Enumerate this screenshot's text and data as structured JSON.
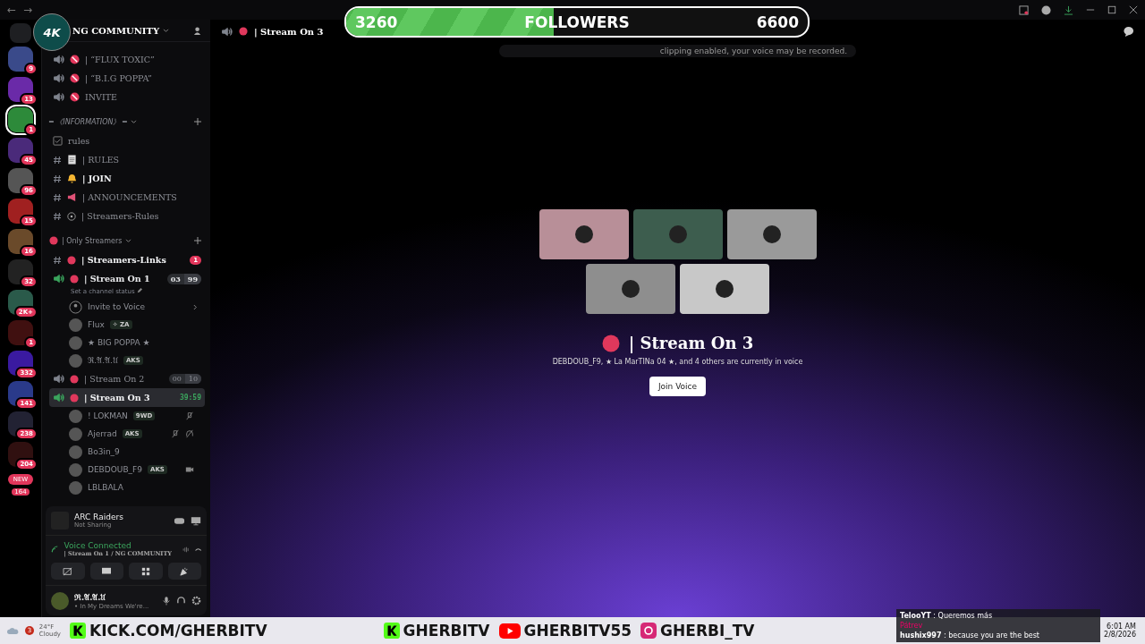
{
  "window": {
    "back": "←",
    "forward": "→"
  },
  "followers": {
    "current": "3260",
    "label": "FOLLOWERS",
    "goal": "6600",
    "level": 0.45
  },
  "stream_logo": {
    "text": "4K"
  },
  "servers": [
    {
      "badge": "9",
      "selected": false
    },
    {
      "badge": "13",
      "selected": false
    },
    {
      "badge": "1",
      "selected": true
    },
    {
      "badge": "45",
      "selected": false
    },
    {
      "badge": "96",
      "selected": false
    },
    {
      "badge": "15",
      "selected": false
    },
    {
      "badge": "16",
      "selected": false
    },
    {
      "badge": "32",
      "selected": false
    },
    {
      "badge": "2K+",
      "selected": false
    },
    {
      "badge": "1",
      "selected": false
    },
    {
      "badge": "332",
      "selected": false
    },
    {
      "badge": "141",
      "selected": false
    },
    {
      "badge": "238",
      "selected": false
    },
    {
      "badge": "204",
      "selected": false
    }
  ],
  "new_pill": {
    "label": "NEW",
    "count": "164"
  },
  "server_header": {
    "title": "NG COMMUNITY"
  },
  "channels": [
    {
      "kind": "voice",
      "name": "| “FLUX TOXIC”",
      "connected": false,
      "selected": false
    },
    {
      "kind": "voice",
      "name": "| “B.I.G POPPA”",
      "connected": false,
      "selected": false
    },
    {
      "kind": "voice",
      "name": "INVITE",
      "connected": false,
      "selected": false
    },
    {
      "kind": "category",
      "name": "═ 《INFORMATION》 ═",
      "children": [
        {
          "kind": "forum",
          "name": "rules",
          "unread": false
        },
        {
          "kind": "text",
          "name": "| RULES",
          "unread": false
        },
        {
          "kind": "text",
          "name": "| JOIN",
          "unread": true
        },
        {
          "kind": "text",
          "name": "| ANNOUNCEMENTS",
          "unread": false
        },
        {
          "kind": "text",
          "name": "| Streamers-Rules",
          "unread": false
        }
      ]
    },
    {
      "kind": "category",
      "name": "| Only Streamers",
      "children": [
        {
          "kind": "text",
          "name": "| Streamers-Links",
          "unread": true,
          "badge": "1"
        },
        {
          "kind": "voice",
          "name": "| Stream On 1",
          "connected": true,
          "selected": false,
          "counts": [
            "03",
            "99"
          ],
          "status": "Set a channel status",
          "children": [
            {
              "kind": "invite",
              "name": "Invite to Voice"
            },
            {
              "kind": "member",
              "name": "Flux",
              "tag": "✧ ZA",
              "muted": false,
              "deafened": false,
              "video": false
            },
            {
              "kind": "member",
              "name": "★ BIG POPPA ★",
              "muted": false,
              "deafened": false,
              "video": false
            },
            {
              "kind": "member",
              "name": "ℜ.𝔄.𝔄.𝔘",
              "tag": "AKS",
              "muted": false,
              "deafened": false,
              "video": false
            }
          ]
        },
        {
          "kind": "voice",
          "name": "| Stream On 2",
          "connected": false,
          "selected": false,
          "counts": [
            "00",
            "10"
          ]
        },
        {
          "kind": "voice",
          "name": "| Stream On 3",
          "connected": true,
          "selected": true,
          "time": "39:59",
          "children": [
            {
              "kind": "member",
              "name": "! LOKMAN",
              "tag": "9WD",
              "muted": true,
              "deafened": false,
              "video": false
            },
            {
              "kind": "member",
              "name": "Ajerrad",
              "tag": "AKS",
              "muted": true,
              "deafened": true,
              "video": false
            },
            {
              "kind": "member",
              "name": "Bo3in_9",
              "muted": false,
              "deafened": false,
              "video": false
            },
            {
              "kind": "member",
              "name": "DEBDOUB_F9",
              "tag": "AKS",
              "muted": false,
              "deafened": false,
              "video": true
            },
            {
              "kind": "member",
              "name": "LBLBALA",
              "muted": false,
              "deafened": false,
              "video": false
            }
          ]
        }
      ]
    }
  ],
  "activity": {
    "title": "ARC Raiders",
    "subtitle": "Not Sharing"
  },
  "voice": {
    "status": "Voice Connected",
    "channel": "| Stream On 1 / NG COMMUNITY"
  },
  "user": {
    "name": "ℜ.𝔄.𝔄.𝔘",
    "status": "• In My Dreams We're..."
  },
  "header": {
    "title": "| Stream On 3"
  },
  "toast": {
    "text": "clipping enabled, your voice may be recorded."
  },
  "tiles": [
    {
      "color": "#b88f98"
    },
    {
      "color": "#3d5d4e"
    },
    {
      "color": "#9a9a9a"
    },
    {
      "color": "#8e8e8e"
    },
    {
      "color": "#c8c8c8"
    }
  ],
  "stage": {
    "title": "| Stream On 3",
    "subtitle": "DEBDOUB_F9, ★ La MarTINa 04 ★, and 4 others are currently in voice",
    "button": "Join Voice"
  },
  "chat": [
    {
      "text": "**TelooYT** : Queremos más"
    },
    {
      "text": "Pátrev"
    },
    {
      "text": "**hushix997** : because you are the best"
    }
  ],
  "taskbar": {
    "weather_badge": "3",
    "temperature": "24°F",
    "condition": "Cloudy",
    "time": "6:01 AM",
    "date": "2/8/2026"
  },
  "socials": [
    {
      "kind": "kick",
      "handle": "KICK.COM/GHERBITV"
    },
    {
      "kind": "kick",
      "handle": "GHERBITV"
    },
    {
      "kind": "youtube",
      "handle": "GHERBITV55"
    },
    {
      "kind": "instagram",
      "handle": "GHERBI_TV"
    }
  ]
}
